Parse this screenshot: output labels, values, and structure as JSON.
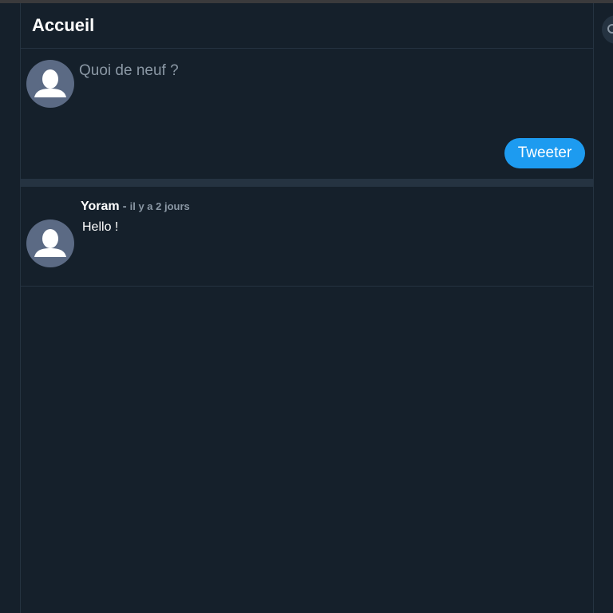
{
  "header": {
    "title": "Accueil"
  },
  "composer": {
    "placeholder": "Quoi de neuf ?",
    "submit_label": "Tweeter"
  },
  "feed": {
    "tweets": [
      {
        "author": "Yoram",
        "separator": "-",
        "time": "il y a 2 jours",
        "text": "Hello !"
      }
    ]
  },
  "icons": {
    "avatar": "default-avatar-icon",
    "search": "search-icon"
  },
  "colors": {
    "background": "#15202b",
    "border": "#253341",
    "accent": "#1d9bf0",
    "avatar": "#5b6a84",
    "muted_text": "#8b98a5"
  }
}
